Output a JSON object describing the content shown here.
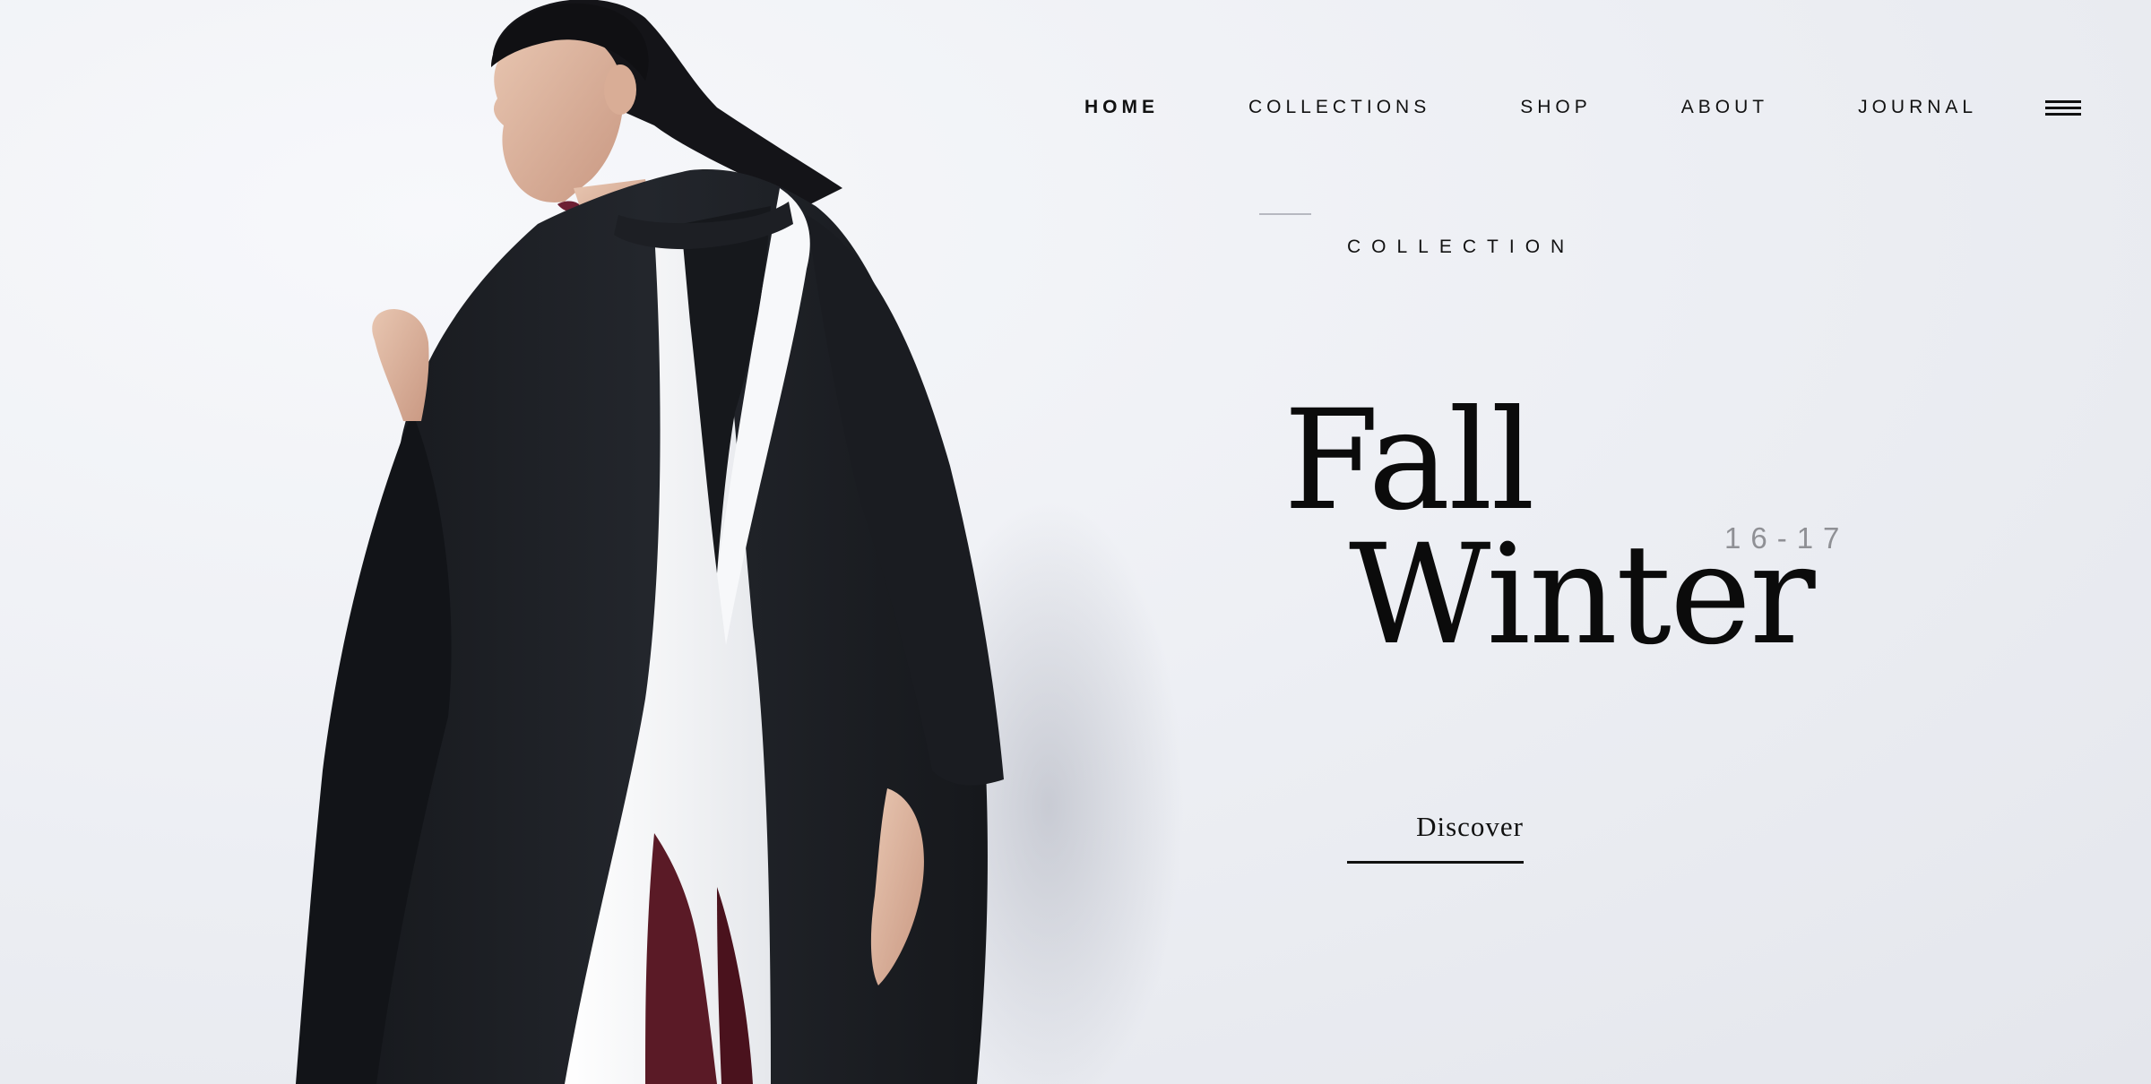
{
  "nav": {
    "items": [
      {
        "label": "HOME",
        "active": true
      },
      {
        "label": "COLLECTIONS",
        "active": false
      },
      {
        "label": "SHOP",
        "active": false
      },
      {
        "label": "ABOUT",
        "active": false
      },
      {
        "label": "JOURNAL",
        "active": false
      }
    ],
    "menu_icon": "hamburger-menu-icon"
  },
  "hero": {
    "eyebrow": "COLLECTION",
    "title_line1": "Fall",
    "title_line2": "Winter",
    "years": "16-17",
    "cta_label": "Discover"
  },
  "colors": {
    "background": "#eeeff4",
    "text": "#111111",
    "muted": "#8f9095",
    "coat": "#1c1e23",
    "scarf": "#f4f5f7",
    "trousers": "#5a1a26"
  }
}
